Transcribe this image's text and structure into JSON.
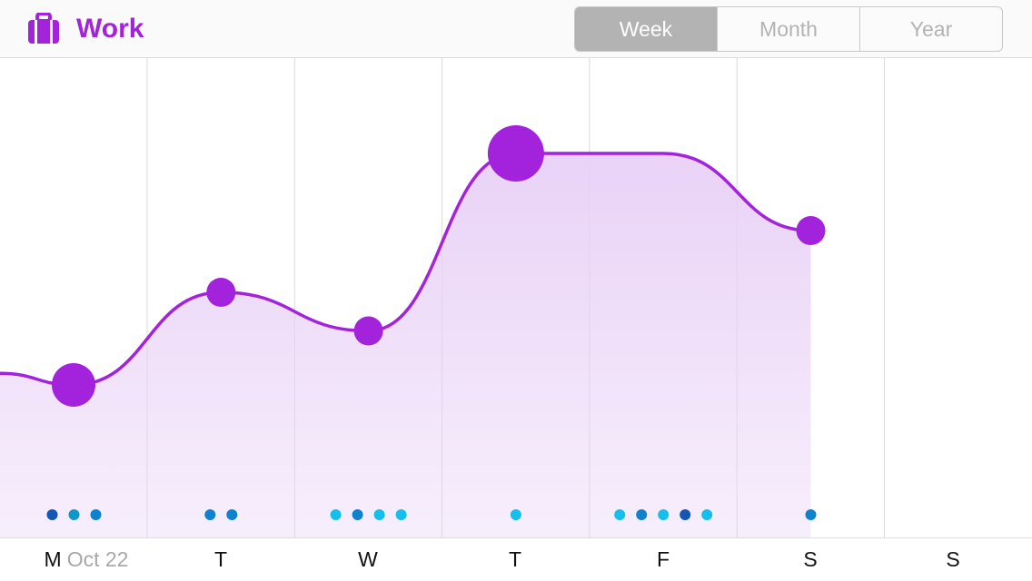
{
  "header": {
    "title": "Work",
    "icon": "briefcase-icon",
    "accent": "#a323dc",
    "segments": [
      {
        "label": "Week",
        "active": true
      },
      {
        "label": "Month",
        "active": false
      },
      {
        "label": "Year",
        "active": false
      }
    ]
  },
  "footer": {
    "days": [
      "M",
      "T",
      "W",
      "T",
      "F",
      "S",
      "S"
    ],
    "first_date": "Oct 22"
  },
  "chart_data": {
    "type": "line",
    "categories": [
      "M",
      "T",
      "W",
      "T",
      "F",
      "S",
      "S"
    ],
    "values": [
      2.0,
      3.2,
      2.7,
      5.0,
      5.0,
      4.0,
      null
    ],
    "point_sizes": [
      "large",
      "medium",
      "medium",
      "xlarge",
      null,
      "medium",
      null
    ],
    "dots": [
      [
        "#1456b4",
        "#1296c8",
        "#0f82cd"
      ],
      [
        "#0f82cd",
        "#0f82cd"
      ],
      [
        "#14c0eb",
        "#0f82cd",
        "#14c0eb",
        "#14c0eb"
      ],
      [
        "#14c0eb"
      ],
      [
        "#14c0eb",
        "#0f82cd",
        "#14c0eb",
        "#1456b4",
        "#14c0eb"
      ],
      [
        "#0f82cd"
      ],
      []
    ],
    "area_fill": "#e8d0f6",
    "grid": true,
    "title": "",
    "xlabel": "",
    "ylabel": ""
  }
}
